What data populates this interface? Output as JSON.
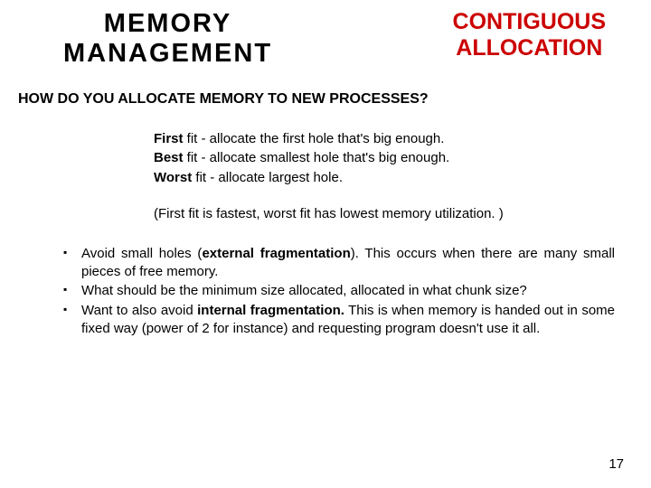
{
  "header": {
    "title_left_line1": "MEMORY",
    "title_left_line2": "MANAGEMENT",
    "title_right_line1": "CONTIGUOUS",
    "title_right_line2": "ALLOCATION"
  },
  "question": "HOW DO YOU ALLOCATE MEMORY TO NEW PROCESSES?",
  "fits": [
    {
      "name": "First",
      "rest": " fit - allocate the first hole that's big enough."
    },
    {
      "name": "Best",
      "rest": " fit - allocate smallest hole that's big enough."
    },
    {
      "name": "Worst",
      "rest": " fit - allocate largest hole."
    }
  ],
  "fit_note": "(First fit is fastest, worst fit has lowest memory utilization. )",
  "bullets": [
    {
      "pre": "Avoid small holes (",
      "bold": "external fragmentation",
      "post": "). This occurs when there are many small pieces of free memory."
    },
    {
      "pre": "What should be the minimum size allocated, allocated in what chunk size?",
      "bold": "",
      "post": ""
    },
    {
      "pre": "Want to also avoid ",
      "bold": "internal fragmentation.",
      "post": " This is when memory is handed out in some fixed way (power of 2 for instance) and requesting program doesn't use it all."
    }
  ],
  "page_number": "17"
}
